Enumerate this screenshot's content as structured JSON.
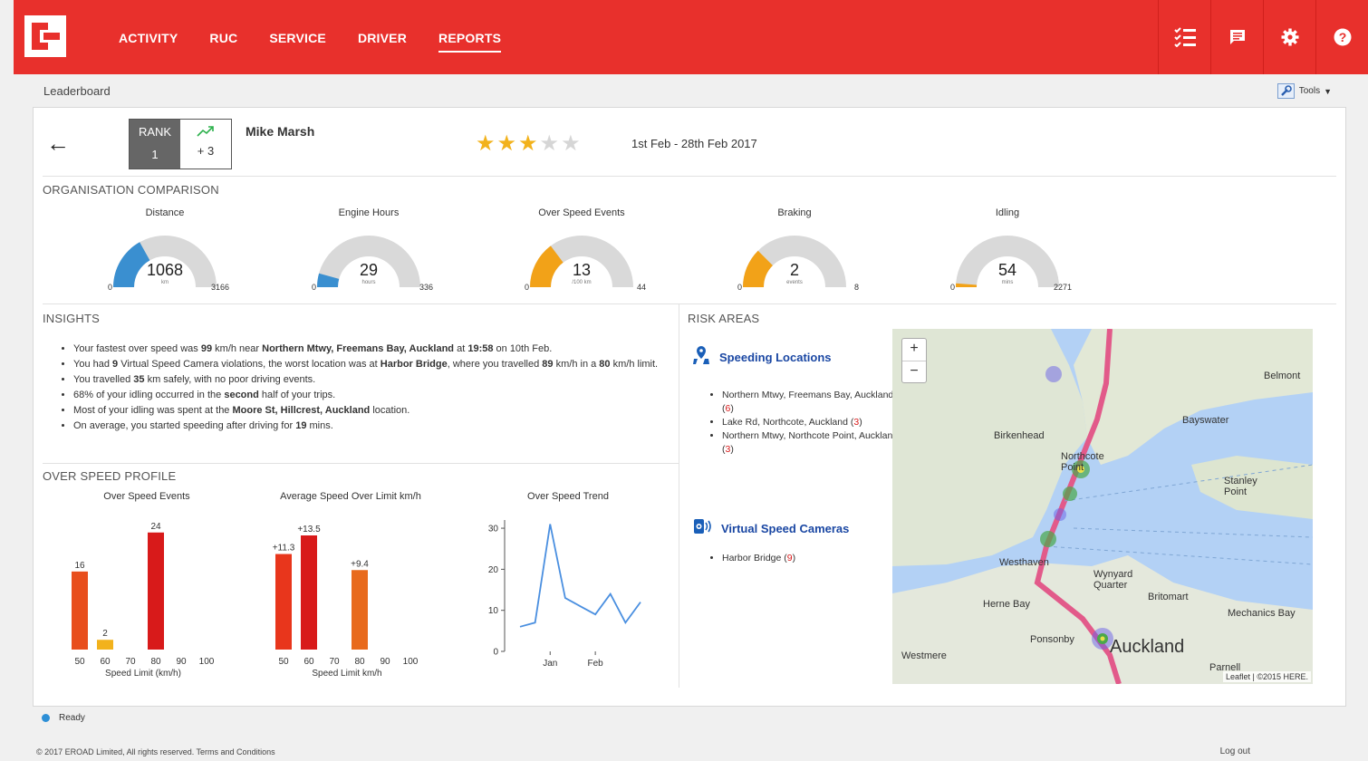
{
  "nav": {
    "items": [
      {
        "label": "ACTIVITY",
        "active": false
      },
      {
        "label": "RUC",
        "active": false
      },
      {
        "label": "SERVICE",
        "active": false
      },
      {
        "label": "DRIVER",
        "active": false
      },
      {
        "label": "REPORTS",
        "active": true
      }
    ],
    "icons": [
      "checklist-icon",
      "message-icon",
      "gear-icon",
      "help-icon"
    ],
    "accent": "#e8302c"
  },
  "page": {
    "title": "Leaderboard",
    "tools_label": "Tools"
  },
  "driver": {
    "rank_label": "RANK",
    "rank": "1",
    "rank_change": "+ 3",
    "name": "Mike Marsh",
    "rating": 3,
    "rating_max": 5,
    "date_range": "1st Feb - 28th Feb 2017"
  },
  "comparison": {
    "title": "ORGANISATION COMPARISON",
    "gauges": [
      {
        "title": "Distance",
        "value": 1068,
        "display": "1068",
        "unit": "km",
        "min": "0",
        "max": "3166",
        "color": "#3a8fd0"
      },
      {
        "title": "Engine Hours",
        "value": 29,
        "display": "29",
        "unit": "hours",
        "min": "0",
        "max": "336",
        "color": "#3a8fd0"
      },
      {
        "title": "Over Speed Events",
        "value": 13,
        "display": "13",
        "unit": "/100 km",
        "min": "0",
        "max": "44",
        "color": "#f2a218"
      },
      {
        "title": "Braking",
        "value": 2,
        "display": "2",
        "unit": "events",
        "min": "0",
        "max": "8",
        "color": "#f2a218"
      },
      {
        "title": "Idling",
        "value": 54,
        "display": "54",
        "unit": "mins",
        "min": "0",
        "max": "2271",
        "color": "#f2a218"
      }
    ]
  },
  "insights": {
    "title": "INSIGHTS",
    "items": [
      "Your fastest over speed was 99 km/h near Northern Mtwy, Freemans Bay, Auckland at 19:58 on 10th Feb.",
      "You had 9 Virtual Speed Camera violations, the worst location was at Harbor Bridge, where you travelled 89 km/h in a 80 km/h limit.",
      "You travelled 35 km safely, with no poor driving events.",
      "68% of your idling occurred in the second half of your trips.",
      "Most of your idling was spent at the Moore St, Hillcrest, Auckland location.",
      "On average, you started speeding after driving for 19 mins."
    ]
  },
  "over_speed_profile": {
    "title": "OVER SPEED PROFILE"
  },
  "risk_areas": {
    "title": "RISK AREAS",
    "speeding_title": "Speeding Locations",
    "speeding_items": [
      "Northern Mtwy, Freemans Bay, Auckland (6)",
      "Lake Rd, Northcote, Auckland (3)",
      "Northern Mtwy, Northcote Point, Auckland (3)"
    ],
    "cameras_title": "Virtual Speed Cameras",
    "camera_items": [
      "Harbor Bridge (9)"
    ],
    "map_labels": [
      "Birkenhead",
      "Northcote Point",
      "Belmont",
      "Bayswater",
      "Stanley Point",
      "Westhaven",
      "Wynyard Quarter",
      "Herne Bay",
      "Ponsonby",
      "Auckland",
      "Westmere",
      "Parnell",
      "Mechanics Bay",
      "Britomart"
    ],
    "map_attribution": "Leaflet | ©2015 HERE."
  },
  "status": {
    "text": "Ready"
  },
  "footer": {
    "copyright": "© 2017 EROAD Limited, All rights reserved.   Terms and Conditions",
    "logout": "Log out"
  },
  "chart_data": [
    {
      "type": "bar",
      "title": "Over Speed Events",
      "xlabel": "Speed Limit (km/h)",
      "categories": [
        "50",
        "60",
        "70",
        "80",
        "90",
        "100"
      ],
      "values": [
        16,
        2,
        null,
        24,
        null,
        null
      ],
      "labels": [
        "16",
        "2",
        "",
        "24",
        "",
        ""
      ],
      "colors": [
        "#e84e1c",
        "#f2b21c",
        "",
        "#d81a1a",
        "",
        ""
      ],
      "ylim": [
        0,
        26
      ]
    },
    {
      "type": "bar",
      "title": "Average Speed Over Limit km/h",
      "xlabel": "Speed Limit km/h",
      "categories": [
        "50",
        "60",
        "70",
        "80",
        "90",
        "100"
      ],
      "values": [
        11.3,
        13.5,
        null,
        9.4,
        null,
        null
      ],
      "labels": [
        "+11.3",
        "+13.5",
        "",
        "+9.4",
        "",
        ""
      ],
      "colors": [
        "#e8361c",
        "#d81a1a",
        "",
        "#e86a1c",
        "",
        ""
      ],
      "ylim": [
        0,
        15
      ]
    },
    {
      "type": "line",
      "title": "Over Speed Trend",
      "x_ticks": [
        "Jan",
        "Feb"
      ],
      "y_ticks": [
        "0",
        "10",
        "20",
        "30"
      ],
      "values": [
        6,
        7,
        31,
        13,
        11,
        9,
        14,
        7,
        12
      ],
      "ylim": [
        0,
        32
      ],
      "color": "#4a8fe0"
    }
  ]
}
